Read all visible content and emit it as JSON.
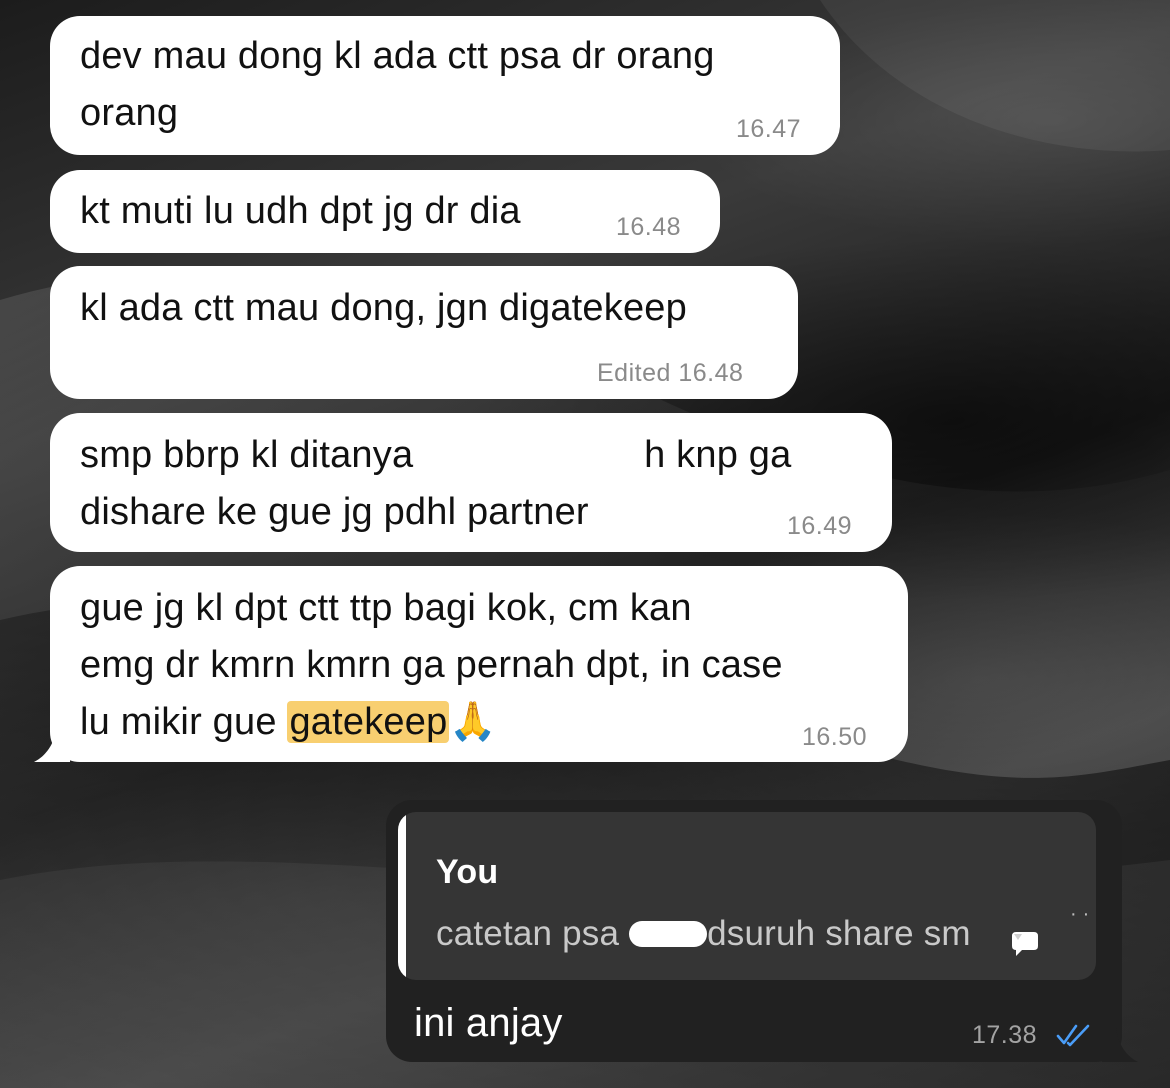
{
  "messages_incoming": [
    {
      "lines": [
        "dev mau dong kl ada ctt psa dr orang",
        "orang"
      ],
      "time": "16.47"
    },
    {
      "lines": [
        "kt muti lu udh dpt jg dr dia"
      ],
      "time": "16.48"
    },
    {
      "lines": [
        "kl ada ctt mau dong, jgn digatekeep"
      ],
      "edited_label": "Edited",
      "time": "16.48"
    },
    {
      "line1_before": "smp bbrp kl ditanya ",
      "line1_after": "h knp ga",
      "line2": "dishare ke gue jg pdhl partner",
      "time": "16.49"
    },
    {
      "line1": "gue jg kl dpt ctt ttp bagi kok, cm kan",
      "line2": "emg dr kmrn kmrn ga pernah dpt, in case",
      "line3_before": "lu mikir gue ",
      "line3_highlight": "gatekeep",
      "line3_emoji": "🙏",
      "time": "16.50"
    }
  ],
  "message_outgoing": {
    "quoted_author": "You",
    "quoted_before": "catetan psa ",
    "quoted_after": "dsuruh share sm",
    "text": "ini anjay",
    "time": "17.38",
    "status": "read-double-check-icon",
    "colors": {
      "bubble": "#212121",
      "quote_bg": "#353535",
      "check": "#4a9df8"
    }
  },
  "colors": {
    "incoming_bubble": "#ffffff",
    "highlight": "#f8cf70",
    "timestamp": "#8a8a8a"
  }
}
